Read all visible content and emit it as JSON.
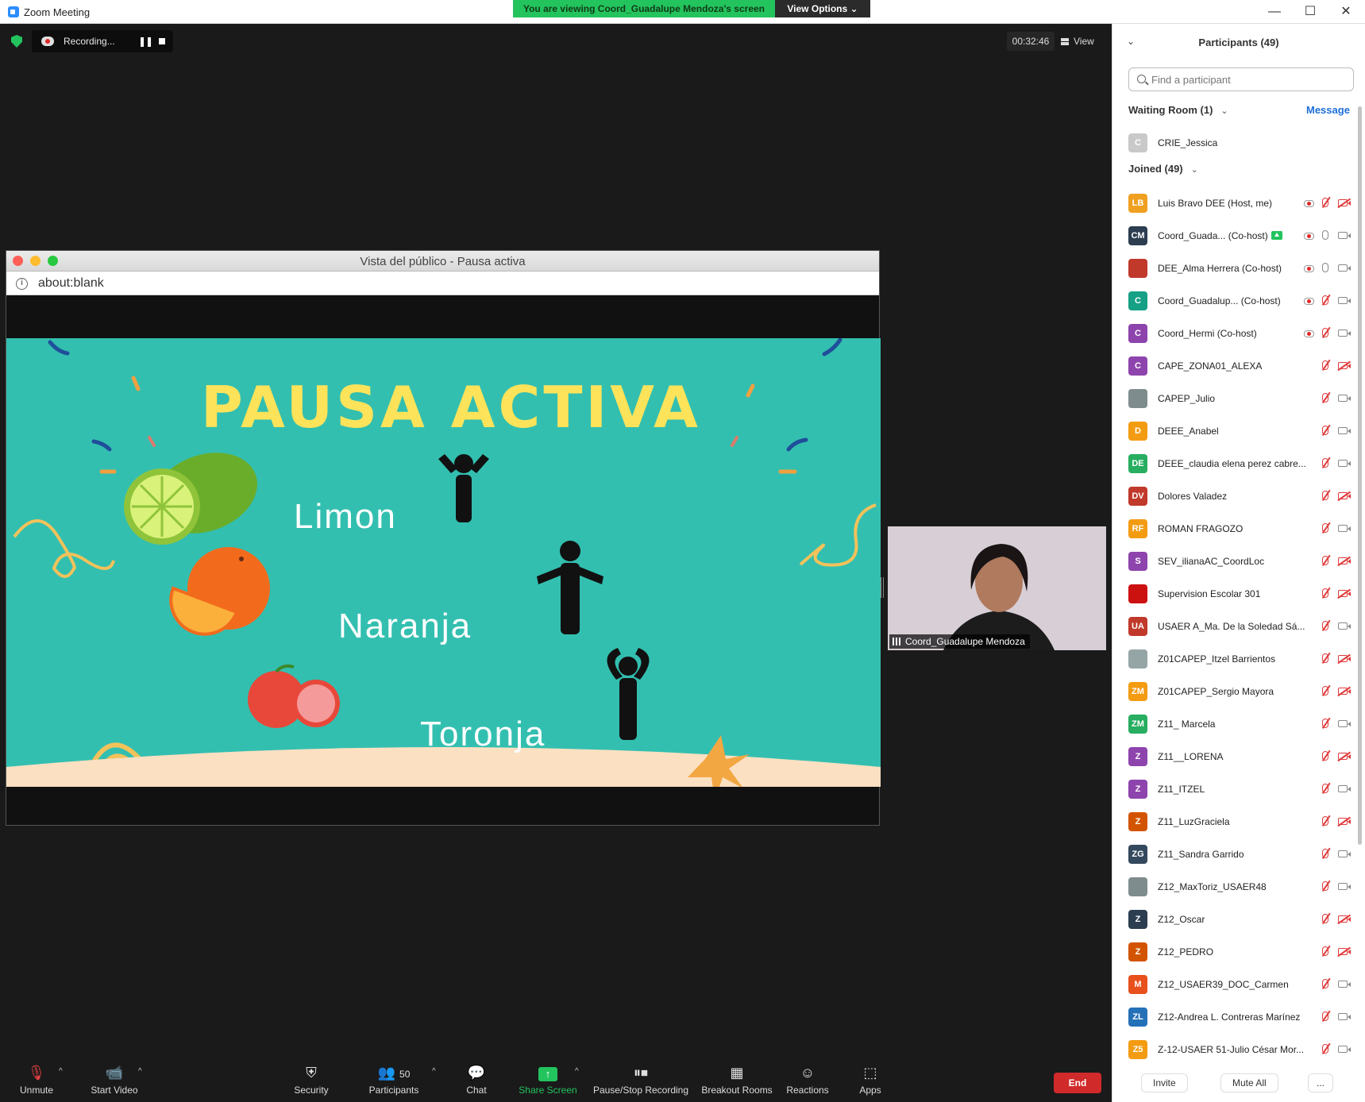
{
  "window": {
    "title": "Zoom Meeting"
  },
  "banner": {
    "viewing_text": "You are viewing Coord_Guadalupe Mendoza's screen",
    "view_options_label": "View Options"
  },
  "meeting": {
    "recording_label": "Recording...",
    "timer": "00:32:46",
    "view_label": "View"
  },
  "shared_browser": {
    "title": "Vista del público - Pausa activa",
    "address": "about:blank",
    "slide": {
      "heading": "PAUSA ACTIVA",
      "items": [
        "Limon",
        "Naranja",
        "Toronja"
      ]
    }
  },
  "participant_video": {
    "name": "Coord_Guadalupe Mendoza"
  },
  "toolbar": {
    "unmute": "Unmute",
    "start_video": "Start Video",
    "security": "Security",
    "participants": "Participants",
    "participants_count": "50",
    "chat": "Chat",
    "share_screen": "Share Screen",
    "pause_stop_recording": "Pause/Stop Recording",
    "breakout_rooms": "Breakout Rooms",
    "reactions": "Reactions",
    "apps": "Apps",
    "end": "End"
  },
  "panel": {
    "title": "Participants (49)",
    "search_placeholder": "Find a participant",
    "waiting_room": {
      "label": "Waiting Room (1)",
      "message_label": "Message",
      "people": [
        {
          "initials": "C",
          "name": "CRIE_Jessica",
          "color": "#c9c9c9"
        }
      ]
    },
    "joined": {
      "label": "Joined (49)",
      "people": [
        {
          "initials": "LB",
          "name": "Luis Bravo DEE (Host, me)",
          "color": "#f0a020",
          "rec": true,
          "mic": "muted",
          "cam": "off"
        },
        {
          "initials": "CM",
          "name": "Coord_Guada... (Co-host)",
          "color": "#2c3e50",
          "rec": true,
          "mic": "on",
          "cam": "on",
          "sharing": true
        },
        {
          "initials": "",
          "name": "DEE_Alma Herrera (Co-host)",
          "color": "#c0392b",
          "rec": true,
          "mic": "on",
          "cam": "on"
        },
        {
          "initials": "C",
          "name": "Coord_Guadalup...  (Co-host)",
          "color": "#16a085",
          "rec": true,
          "mic": "muted",
          "cam": "on"
        },
        {
          "initials": "C",
          "name": "Coord_Hermi (Co-host)",
          "color": "#8e44ad",
          "rec": true,
          "mic": "muted",
          "cam": "on"
        },
        {
          "initials": "C",
          "name": "CAPE_ZONA01_ALEXA",
          "color": "#8e44ad",
          "mic": "muted",
          "cam": "off"
        },
        {
          "initials": "",
          "name": "CAPEP_Julio",
          "color": "#7f8c8d",
          "mic": "muted",
          "cam": "on"
        },
        {
          "initials": "D",
          "name": "DEEE_Anabel",
          "color": "#f39c12",
          "mic": "muted",
          "cam": "on"
        },
        {
          "initials": "DE",
          "name": "DEEE_claudia elena perez cabre...",
          "color": "#27ae60",
          "mic": "muted",
          "cam": "on"
        },
        {
          "initials": "DV",
          "name": "Dolores Valadez",
          "color": "#c0392b",
          "mic": "muted",
          "cam": "off"
        },
        {
          "initials": "RF",
          "name": "ROMAN FRAGOZO",
          "color": "#f39c12",
          "mic": "muted",
          "cam": "on"
        },
        {
          "initials": "S",
          "name": "SEV_ilianaAC_CoordLoc",
          "color": "#8e44ad",
          "mic": "muted",
          "cam": "off"
        },
        {
          "initials": "",
          "name": "Supervision Escolar 301",
          "color": "#cc1111",
          "mic": "muted",
          "cam": "off"
        },
        {
          "initials": "UA",
          "name": "USAER A_Ma. De la Soledad Sá...",
          "color": "#c0392b",
          "mic": "muted",
          "cam": "on"
        },
        {
          "initials": "",
          "name": "Z01CAPEP_Itzel Barrientos",
          "color": "#95a5a6",
          "mic": "muted",
          "cam": "off"
        },
        {
          "initials": "ZM",
          "name": "Z01CAPEP_Sergio Mayora",
          "color": "#f39c12",
          "mic": "muted",
          "cam": "off"
        },
        {
          "initials": "ZM",
          "name": "Z11_ Marcela",
          "color": "#27ae60",
          "mic": "muted",
          "cam": "on"
        },
        {
          "initials": "Z",
          "name": "Z11__LORENA",
          "color": "#8e44ad",
          "mic": "muted",
          "cam": "off"
        },
        {
          "initials": "Z",
          "name": "Z11_ITZEL",
          "color": "#8e44ad",
          "mic": "muted",
          "cam": "on"
        },
        {
          "initials": "Z",
          "name": "Z11_LuzGraciela",
          "color": "#d35400",
          "mic": "muted",
          "cam": "off"
        },
        {
          "initials": "ZG",
          "name": "Z11_Sandra Garrido",
          "color": "#34495e",
          "mic": "muted",
          "cam": "on"
        },
        {
          "initials": "",
          "name": "Z12_MaxToriz_USAER48",
          "color": "#7f8c8d",
          "mic": "muted",
          "cam": "on"
        },
        {
          "initials": "Z",
          "name": "Z12_Oscar",
          "color": "#2c3e50",
          "mic": "muted",
          "cam": "off"
        },
        {
          "initials": "Z",
          "name": "Z12_PEDRO",
          "color": "#d35400",
          "mic": "muted",
          "cam": "off"
        },
        {
          "initials": "M",
          "name": "Z12_USAER39_DOC_Carmen",
          "color": "#e8501e",
          "mic": "muted",
          "cam": "on"
        },
        {
          "initials": "ZL",
          "name": "Z12-Andrea L. Contreras Marínez",
          "color": "#2471b8",
          "mic": "muted",
          "cam": "on"
        },
        {
          "initials": "Z5",
          "name": "Z-12-USAER 51-Julio César Mor...",
          "color": "#f39c12",
          "mic": "muted",
          "cam": "on"
        }
      ]
    },
    "buttons": {
      "invite": "Invite",
      "mute_all": "Mute All",
      "more": "..."
    }
  }
}
